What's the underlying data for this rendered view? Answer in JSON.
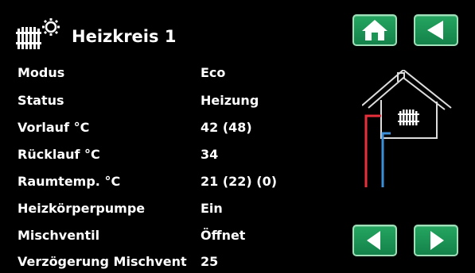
{
  "header": {
    "icon": "radiator-heating-icon",
    "title": "Heizkreis 1"
  },
  "nav": {
    "home_icon": "home-icon",
    "back_icon": "back-arrow-icon",
    "prev_icon": "previous-arrow-icon",
    "next_icon": "next-arrow-icon",
    "accent_color": "#1a9655"
  },
  "rows": [
    {
      "label": "Modus",
      "value": "Eco"
    },
    {
      "label": "Status",
      "value": "Heizung"
    },
    {
      "label": "Vorlauf °C",
      "value": "42 (48)"
    },
    {
      "label": "Rücklauf °C",
      "value": "34"
    },
    {
      "label": "Raumtemp. °C",
      "value": "21 (22) (0)"
    },
    {
      "label": "Heizkörperpumpe",
      "value": "Ein"
    },
    {
      "label": "Mischventil",
      "value": "Öffnet"
    },
    {
      "label": "Verzögerung Mischvent",
      "value": "25"
    }
  ],
  "diagram": {
    "icon": "house-radiator-icon",
    "supply_color": "#e8303c",
    "return_color": "#3a8fd8"
  }
}
